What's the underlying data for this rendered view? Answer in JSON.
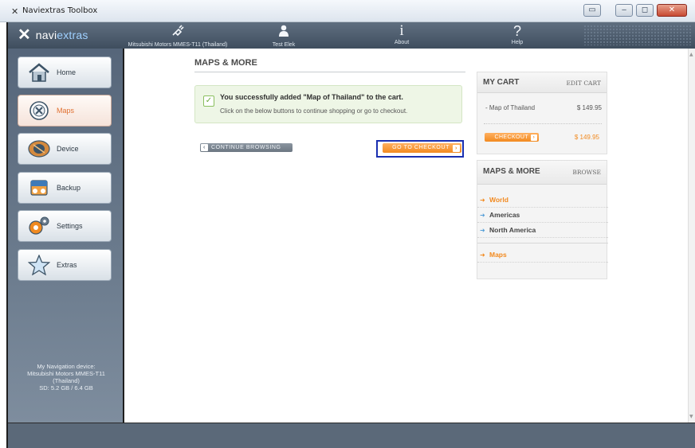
{
  "window": {
    "title": "Naviextras Toolbox",
    "title_icon": "x-logo-icon",
    "controls": [
      "system-menu",
      "minimize",
      "maximize",
      "close"
    ]
  },
  "header": {
    "logo_prefix": "navi",
    "logo_suffix": "extras",
    "items": [
      {
        "label": "Mitsubishi Motors MMES-T11 (Thailand)",
        "icon": "device-plug-icon"
      },
      {
        "label": "Test Elek",
        "icon": "user-icon"
      },
      {
        "label": "About",
        "icon": "info-icon"
      },
      {
        "label": "Help",
        "icon": "help-icon"
      }
    ]
  },
  "sidebar": {
    "items": [
      {
        "label": "Home",
        "icon": "home-icon",
        "active": false
      },
      {
        "label": "Maps",
        "icon": "maps-icon",
        "active": true
      },
      {
        "label": "Device",
        "icon": "device-icon",
        "active": false
      },
      {
        "label": "Backup",
        "icon": "backup-icon",
        "active": false
      },
      {
        "label": "Settings",
        "icon": "settings-icon",
        "active": false
      },
      {
        "label": "Extras",
        "icon": "star-icon",
        "active": false
      }
    ],
    "device_info": {
      "line1": "My Navigation device:",
      "line2": "Mitsubishi Motors MMES-T11",
      "line3": "(Thailand)",
      "line4": "SD: 5.2 GB / 6.4 GB"
    }
  },
  "main": {
    "title": "MAPS & MORE",
    "success": {
      "title": "You successfully added \"Map of Thailand\" to the cart.",
      "subtitle": "Click on the below buttons to continue shopping or go to checkout."
    },
    "continue_label": "CONTINUE BROWSING",
    "checkout_label": "GO TO CHECKOUT"
  },
  "cart": {
    "title": "MY CART",
    "edit_label": "EDIT CART",
    "items": [
      {
        "name": "- Map of Thailand",
        "price": "$ 149.95"
      }
    ],
    "checkout_label": "CHECKOUT",
    "total": "$ 149.95"
  },
  "maps_panel": {
    "title": "MAPS & MORE",
    "browse_label": "BROWSE",
    "items": [
      {
        "label": "World",
        "style": "orange"
      },
      {
        "label": "Americas",
        "style": "blue"
      },
      {
        "label": "North America",
        "style": "blue"
      },
      {
        "label": "Maps",
        "style": "orange"
      }
    ]
  },
  "colors": {
    "accent_orange": "#f28a20",
    "header_dark": "#4a5a6b",
    "highlight_frame": "#1a2fb0",
    "success_bg": "#eef6e6"
  }
}
